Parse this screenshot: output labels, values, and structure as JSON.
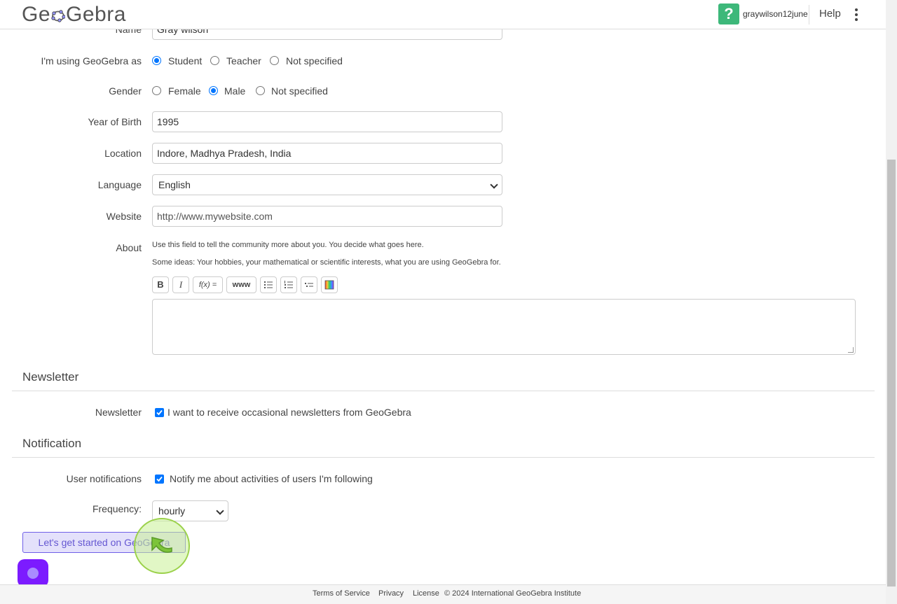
{
  "header": {
    "logo_text_left": "Ge",
    "logo_text_right": "Gebra",
    "username": "graywilson12june",
    "help_label": "Help"
  },
  "form": {
    "name_label": "Name",
    "name_value": "Gray wilson",
    "using_as_label": "I'm using GeoGebra as",
    "using_as_options": [
      "Student",
      "Teacher",
      "Not specified"
    ],
    "using_as_selected": "Student",
    "gender_label": "Gender",
    "gender_options": [
      "Female",
      "Male",
      "Not specified"
    ],
    "gender_selected": "Male",
    "year_label": "Year of Birth",
    "year_value": "1995",
    "location_label": "Location",
    "location_value": "Indore, Madhya Pradesh, India",
    "language_label": "Language",
    "language_value": "English",
    "website_label": "Website",
    "website_placeholder": "http://www.mywebsite.com",
    "about_label": "About",
    "about_hint1": "Use this field to tell the community more about you. You decide what goes here.",
    "about_hint2": "Some ideas: Your hobbies, your mathematical or scientific interests, what you are using GeoGebra for.",
    "toolbar": {
      "bold": "B",
      "italic": "I",
      "formula": "f(x) =",
      "link": "www"
    }
  },
  "newsletter": {
    "section_title": "Newsletter",
    "label": "Newsletter",
    "checkbox_text": "I want to receive occasional newsletters from GeoGebra",
    "checked": true
  },
  "notification": {
    "section_title": "Notification",
    "user_notifications_label": "User notifications",
    "user_notifications_text": "Notify me about activities of users I'm following",
    "checked": true,
    "frequency_label": "Frequency:",
    "frequency_value": "hourly"
  },
  "cta_label": "Let's get started on GeoGebra",
  "footer": {
    "terms": "Terms of Service",
    "privacy": "Privacy",
    "license": "License",
    "copyright": "© 2024 International GeoGebra Institute"
  },
  "colors": {
    "accent": "#0075ff",
    "help_green": "#3db87a",
    "cta_border": "#6f5fe8",
    "chat_purple": "#7c1bff"
  }
}
